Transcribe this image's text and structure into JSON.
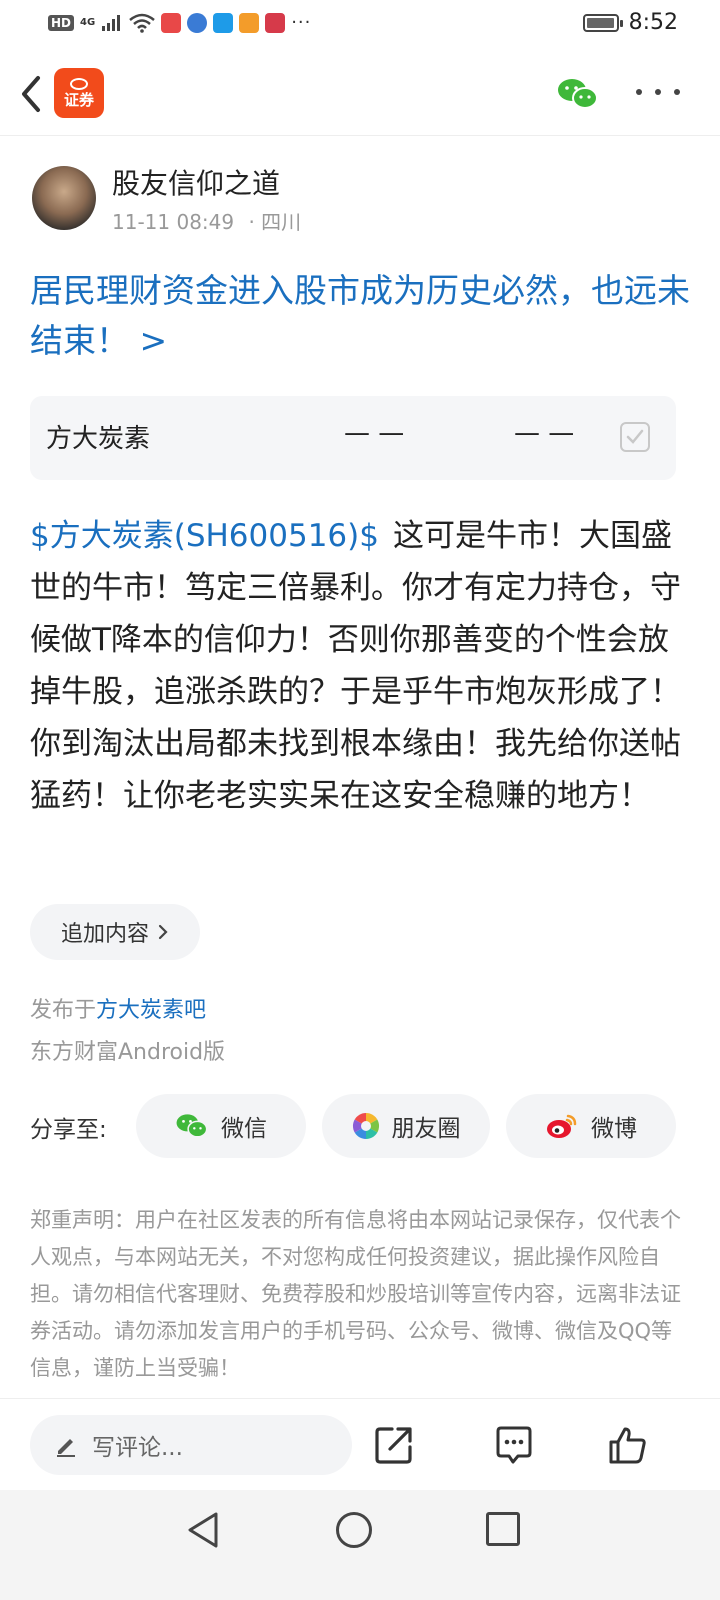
{
  "status_bar": {
    "hd": "HD",
    "network": "4G",
    "time": "8:52",
    "battery_level": 0.85,
    "more_notifications": "···"
  },
  "header": {
    "app_logo_text": "证券",
    "back_icon": "chevron-left-icon",
    "wechat_icon": "wechat-icon",
    "more_icon": "more-horizontal-icon"
  },
  "post": {
    "author": "股友信仰之道",
    "time": "11-11 08:49",
    "location": "· 四川",
    "title": "居民理财资金进入股市成为历史必然，也远未结束！ >",
    "stock_card": {
      "name": "方大炭素",
      "price": "— —",
      "change": "— —"
    },
    "body_tag": "$方大炭素(SH600516)$",
    "body_text": "这可是牛市！大国盛世的牛市！笃定三倍暴利。你才有定力持仓，守候做T降本的信仰力！否则你那善变的个性会放掉牛股，追涨杀跌的？于是乎牛市炮灰形成了！你到淘汰出局都未找到根本缘由！我先给你送帖猛药！让你老老实实呆在这安全稳赚的地方！",
    "add_content_label": "追加内容",
    "publish_prefix": "发布于",
    "publish_forum": "方大炭素吧",
    "client": "东方财富Android版"
  },
  "share": {
    "label": "分享至:",
    "wechat": "微信",
    "moments": "朋友圈",
    "weibo": "微博"
  },
  "disclaimer": "郑重声明：用户在社区发表的所有信息将由本网站记录保存，仅代表个人观点，与本网站无关，不对您构成任何投资建议，据此操作风险自担。请勿相信代客理财、免费荐股和炒股培训等宣传内容，远离非法证券活动。请勿添加发言用户的手机号码、公众号、微博、微信及QQ等信息，谨防上当受骗！",
  "bottom_bar": {
    "comment_placeholder": "写评论..."
  },
  "colors": {
    "link_blue": "#1a6fbf",
    "brand_orange": "#f24b1b",
    "wechat_green": "#3fb83a",
    "weibo_red": "#e6162d"
  }
}
